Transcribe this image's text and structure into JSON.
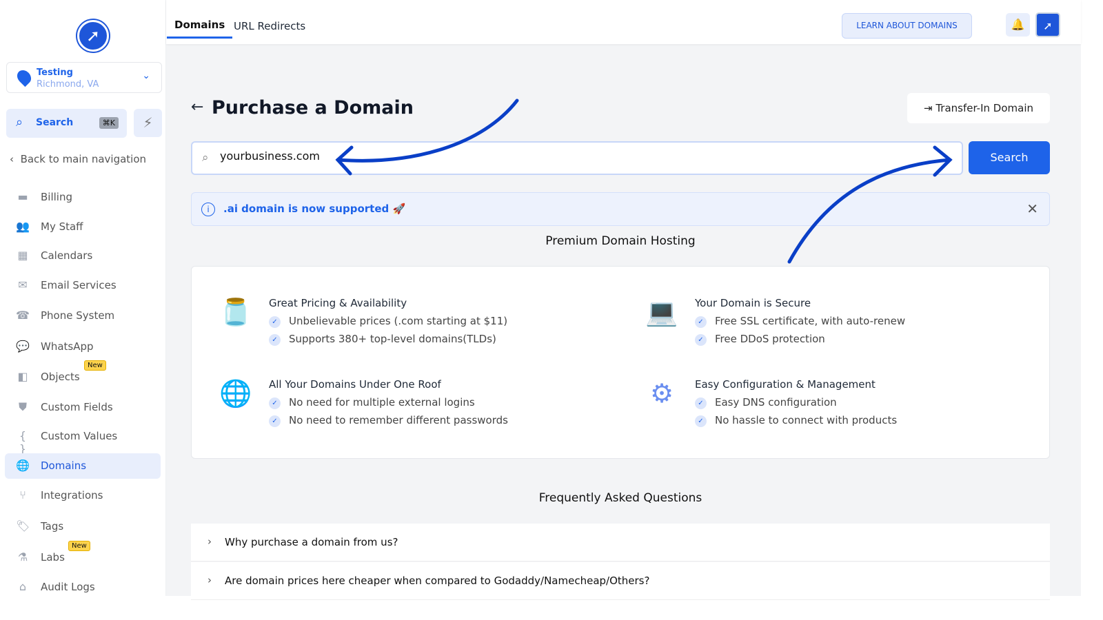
{
  "sidebar": {
    "location": {
      "name": "Testing",
      "address": "Richmond, VA"
    },
    "search": {
      "label": "Search",
      "shortcut": "⌘K"
    },
    "back": "Back to main navigation",
    "items": [
      {
        "label": "Billing",
        "icon": "wallet-icon",
        "glyph": "▬"
      },
      {
        "label": "My Staff",
        "icon": "users-icon",
        "glyph": "👥"
      },
      {
        "label": "Calendars",
        "icon": "calendar-icon",
        "glyph": "▦"
      },
      {
        "label": "Email Services",
        "icon": "mail-icon",
        "glyph": "✉"
      },
      {
        "label": "Phone System",
        "icon": "phone-icon",
        "glyph": "☎"
      },
      {
        "label": "WhatsApp",
        "icon": "chat-icon",
        "glyph": "💬"
      },
      {
        "label": "Objects",
        "icon": "objects-icon",
        "glyph": "◧",
        "badge": "New"
      },
      {
        "label": "Custom Fields",
        "icon": "shield-icon",
        "glyph": "⛊"
      },
      {
        "label": "Custom Values",
        "icon": "braces-icon",
        "glyph": "{ }"
      },
      {
        "label": "Domains",
        "icon": "globe-icon",
        "glyph": "🌐"
      },
      {
        "label": "Integrations",
        "icon": "integrations-icon",
        "glyph": "⑂"
      },
      {
        "label": "Tags",
        "icon": "tag-icon",
        "glyph": "🏷"
      },
      {
        "label": "Labs",
        "icon": "flask-icon",
        "glyph": "⚗",
        "badge": "New"
      },
      {
        "label": "Audit Logs",
        "icon": "audit-icon",
        "glyph": "⌂"
      }
    ]
  },
  "topbar": {
    "tabs": [
      "Domains",
      "URL Redirects"
    ],
    "learn": "LEARN ABOUT DOMAINS"
  },
  "page": {
    "title": "Purchase a Domain",
    "transfer": "Transfer-In Domain",
    "search_value": "yourbusiness.com",
    "search_button": "Search",
    "alert": ".ai domain is now supported 🚀",
    "hosting_title": "Premium Domain Hosting",
    "features": [
      {
        "title": "Great Pricing & Availability",
        "icon": "coin-jar-icon",
        "glyph": "🫙",
        "items": [
          "Unbelievable prices (.com starting at $11)",
          "Supports 380+ top-level domains(TLDs)"
        ]
      },
      {
        "title": "Your Domain is Secure",
        "icon": "secure-laptop-icon",
        "glyph": "💻",
        "items": [
          "Free SSL certificate, with auto-renew",
          "Free DDoS protection"
        ]
      },
      {
        "title": "All Your Domains Under One Roof",
        "icon": "globe-network-icon",
        "glyph": "🌐",
        "items": [
          "No need for multiple external logins",
          "No need to remember different passwords"
        ]
      },
      {
        "title": "Easy Configuration & Management",
        "icon": "network-config-icon",
        "glyph": "⚙",
        "items": [
          "Easy DNS configuration",
          "No hassle to connect with products"
        ]
      }
    ],
    "faq_title": "Frequently Asked Questions",
    "faqs": [
      "Why purchase a domain from us?",
      "Are domain prices here cheaper when compared to Godaddy/Namecheap/Others?"
    ]
  },
  "colors": {
    "accent": "#1e63e9",
    "annotation": "#0a3fc7"
  }
}
